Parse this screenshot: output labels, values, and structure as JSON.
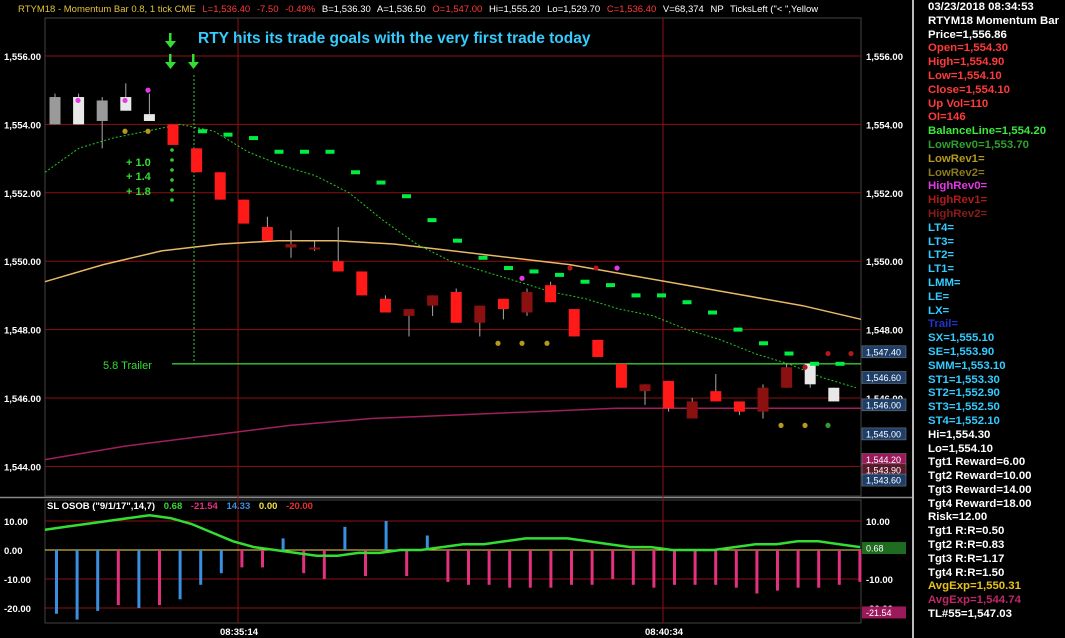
{
  "window": {
    "title_symbol": "RTYM18 - Momentum Bar 0.8, 1 tick  CME",
    "last": "L=1,536.40",
    "change": "-7.50",
    "change_pct": "-0.49%",
    "bid": "B=1,536.30",
    "ask": "A=1,536.50",
    "open": "O=1,547.00",
    "hi": "Hi=1,555.20",
    "lo": "Lo=1,529.70",
    "close": "C=1,536.40",
    "volume": "V=68,374",
    "np": "NP",
    "ticks_left": "TicksLeft (\"< \",Yellow",
    "annotation": "RTY hits its trade goals with the very first trade today",
    "trailer_label": "5.8 Trailer",
    "target_labels": [
      "1.0",
      "1.4",
      "1.8"
    ],
    "time_labels": [
      "08:35:14",
      "08:40:34"
    ]
  },
  "chart_data": [
    {
      "type": "candlestick",
      "symbol": "RTYM18",
      "price_axis": {
        "ticks": [
          1544.0,
          1546.0,
          1548.0,
          1550.0,
          1552.0,
          1554.0,
          1556.0
        ],
        "tick_labels": [
          "1,544.00",
          "1,546.00",
          "1,548.00",
          "1,550.00",
          "1,552.00",
          "1,554.00",
          "1,556.00"
        ],
        "ylim": [
          1543.6,
          1556.5
        ]
      },
      "candles": [
        {
          "o": 1554.8,
          "h": 1554.9,
          "l": 1554.0,
          "c": 1554.0,
          "color": "gray"
        },
        {
          "o": 1554.0,
          "h": 1554.9,
          "l": 1554.0,
          "c": 1554.8,
          "color": "white"
        },
        {
          "o": 1554.7,
          "h": 1554.8,
          "l": 1553.3,
          "c": 1554.1,
          "color": "gray"
        },
        {
          "o": 1554.4,
          "h": 1555.2,
          "l": 1554.4,
          "c": 1554.8,
          "color": "white"
        },
        {
          "o": 1554.1,
          "h": 1554.9,
          "l": 1554.1,
          "c": 1554.3,
          "color": "white"
        },
        {
          "o": 1554.0,
          "h": 1554.0,
          "l": 1553.4,
          "c": 1553.4,
          "color": "red"
        },
        {
          "o": 1553.3,
          "h": 1553.3,
          "l": 1552.6,
          "c": 1552.6,
          "color": "red"
        },
        {
          "o": 1552.6,
          "h": 1552.6,
          "l": 1551.8,
          "c": 1551.8,
          "color": "red"
        },
        {
          "o": 1551.8,
          "h": 1551.8,
          "l": 1551.1,
          "c": 1551.1,
          "color": "red"
        },
        {
          "o": 1551.0,
          "h": 1551.3,
          "l": 1550.6,
          "c": 1550.6,
          "color": "red"
        },
        {
          "o": 1550.5,
          "h": 1550.9,
          "l": 1550.1,
          "c": 1550.4,
          "color": "darkred"
        },
        {
          "o": 1550.4,
          "h": 1550.6,
          "l": 1550.3,
          "c": 1550.4,
          "color": "darkred"
        },
        {
          "o": 1550.0,
          "h": 1551.0,
          "l": 1549.7,
          "c": 1549.7,
          "color": "red"
        },
        {
          "o": 1549.7,
          "h": 1549.7,
          "l": 1549.0,
          "c": 1549.0,
          "color": "red"
        },
        {
          "o": 1548.9,
          "h": 1549.0,
          "l": 1548.5,
          "c": 1548.5,
          "color": "red"
        },
        {
          "o": 1548.6,
          "h": 1548.6,
          "l": 1547.8,
          "c": 1548.4,
          "color": "darkred"
        },
        {
          "o": 1549.0,
          "h": 1549.0,
          "l": 1548.4,
          "c": 1548.7,
          "color": "darkred"
        },
        {
          "o": 1549.1,
          "h": 1549.2,
          "l": 1548.2,
          "c": 1548.2,
          "color": "red"
        },
        {
          "o": 1548.7,
          "h": 1548.7,
          "l": 1547.8,
          "c": 1548.2,
          "color": "darkred"
        },
        {
          "o": 1548.9,
          "h": 1548.9,
          "l": 1548.3,
          "c": 1548.6,
          "color": "red"
        },
        {
          "o": 1549.1,
          "h": 1549.2,
          "l": 1548.4,
          "c": 1548.5,
          "color": "darkred"
        },
        {
          "o": 1549.3,
          "h": 1549.4,
          "l": 1548.8,
          "c": 1548.8,
          "color": "red"
        },
        {
          "o": 1548.6,
          "h": 1548.6,
          "l": 1547.8,
          "c": 1547.8,
          "color": "red"
        },
        {
          "o": 1547.7,
          "h": 1547.7,
          "l": 1547.2,
          "c": 1547.2,
          "color": "red"
        },
        {
          "o": 1547.0,
          "h": 1547.0,
          "l": 1546.3,
          "c": 1546.3,
          "color": "red"
        },
        {
          "o": 1546.4,
          "h": 1546.4,
          "l": 1545.8,
          "c": 1546.2,
          "color": "darkred"
        },
        {
          "o": 1546.5,
          "h": 1546.5,
          "l": 1545.6,
          "c": 1545.7,
          "color": "red"
        },
        {
          "o": 1545.9,
          "h": 1546.0,
          "l": 1545.4,
          "c": 1545.4,
          "color": "darkred"
        },
        {
          "o": 1546.2,
          "h": 1546.7,
          "l": 1545.9,
          "c": 1545.9,
          "color": "red"
        },
        {
          "o": 1545.9,
          "h": 1545.9,
          "l": 1545.5,
          "c": 1545.6,
          "color": "red"
        },
        {
          "o": 1546.3,
          "h": 1546.4,
          "l": 1545.4,
          "c": 1545.6,
          "color": "darkred"
        },
        {
          "o": 1546.9,
          "h": 1547.0,
          "l": 1546.3,
          "c": 1546.3,
          "color": "darkred"
        },
        {
          "o": 1546.4,
          "h": 1546.8,
          "l": 1546.3,
          "c": 1547.0,
          "color": "white"
        },
        {
          "o": 1546.3,
          "h": 1546.3,
          "l": 1545.9,
          "c": 1545.9,
          "color": "white"
        }
      ],
      "trail_stop": [
        1553.8,
        1553.7,
        1553.6,
        1553.2,
        1553.2,
        1553.2,
        1552.6,
        1552.3,
        1551.9,
        1551.2,
        1550.6,
        1550.1,
        1549.8,
        1549.7,
        1549.6,
        1549.4,
        1549.3,
        1549.0,
        1549.0,
        1548.8,
        1548.5,
        1548.0,
        1547.6,
        1547.3,
        1547.0,
        1547.0
      ],
      "balance_line": [
        1552.6,
        1553.3,
        1553.6,
        1553.8,
        1554.0,
        1553.8,
        1553.2,
        1552.8,
        1552.5,
        1552.0,
        1551.2,
        1550.5,
        1550.0,
        1549.7,
        1549.4,
        1549.1,
        1548.9,
        1548.6,
        1548.4,
        1548.0,
        1547.7,
        1547.3,
        1547.0,
        1546.6,
        1546.3
      ],
      "avg_exp_1": [
        1549.4,
        1549.9,
        1550.3,
        1550.5,
        1550.6,
        1550.6,
        1550.5,
        1550.3,
        1550.1,
        1549.9,
        1549.6,
        1549.3,
        1549.0,
        1548.7,
        1548.3
      ],
      "avg_exp_2": [
        1544.2,
        1544.6,
        1544.9,
        1545.2,
        1545.4,
        1545.5,
        1545.6,
        1545.7,
        1545.7,
        1545.7,
        1545.7
      ],
      "trailer_price": 1547.0,
      "right_tags": [
        {
          "text": "1,547.40",
          "color": "#1f3f6b",
          "value": 1547.35
        },
        {
          "text": "1,546.60",
          "color": "#1f3f6b",
          "value": 1546.6
        },
        {
          "text": "1,546.00",
          "color": "#1f3f6b",
          "value": 1545.8
        },
        {
          "text": "1,545.00",
          "color": "#1f3f6b",
          "value": 1544.95
        },
        {
          "text": "1,544.20",
          "color": "#9c1a5b",
          "value": 1544.2
        },
        {
          "text": "1,543.90",
          "color": "#5a1a2a",
          "value": 1543.9
        },
        {
          "text": "1,543.60",
          "color": "#1f3f6b",
          "value": 1543.6
        }
      ]
    },
    {
      "type": "bar",
      "title": "SL  OSOB (\"9/1/17\",14,7)",
      "legend_values": [
        {
          "text": "0.68",
          "color": "#39d539"
        },
        {
          "text": "-21.54",
          "color": "#e2317e"
        },
        {
          "text": "14.33",
          "color": "#3a8fe0"
        },
        {
          "text": "0.00",
          "color": "#f2e14a"
        },
        {
          "text": "-20.00",
          "color": "#e23131"
        }
      ],
      "y_ticks": [
        10.0,
        0.0,
        -10.0,
        -20.0
      ],
      "y_tick_labels": [
        "10.00",
        "0.00",
        "-10.00",
        "-20.00"
      ],
      "ylim": [
        -23,
        13
      ],
      "bars": [
        -22,
        -24,
        -21,
        -19,
        -20,
        -19,
        -17,
        -12,
        -8,
        -6,
        -6,
        4,
        -8,
        -10,
        8,
        -9,
        10,
        -9,
        5,
        -11,
        -12,
        -12,
        -13,
        -13,
        -13,
        -12,
        -12,
        -10,
        -12,
        -13,
        -12,
        -12,
        -12,
        -13,
        -15,
        -14,
        -13,
        -13,
        -12,
        -11
      ],
      "bar_colors": [
        "blue",
        "blue",
        "blue",
        "pink",
        "blue",
        "pink",
        "blue",
        "blue",
        "blue",
        "pink",
        "pink",
        "blue",
        "pink",
        "pink",
        "blue",
        "pink",
        "blue",
        "pink",
        "blue",
        "pink",
        "pink",
        "pink",
        "pink",
        "pink",
        "pink",
        "pink",
        "pink",
        "pink",
        "pink",
        "pink",
        "pink",
        "pink",
        "pink",
        "pink",
        "pink",
        "pink",
        "pink",
        "pink",
        "pink",
        "pink"
      ],
      "green_line": [
        7,
        8,
        9,
        10,
        11,
        12,
        11,
        9,
        6,
        3,
        1,
        0,
        -1,
        -2,
        -2,
        -1,
        -1,
        0,
        0,
        1,
        2,
        2,
        3,
        4,
        4,
        4,
        3,
        2,
        1,
        1,
        0,
        0,
        0,
        1,
        2,
        2,
        3,
        3,
        2,
        1
      ],
      "right_tags": [
        {
          "text": "0.68",
          "color": "#1f6b1f",
          "value": 0.68
        },
        {
          "text": "-21.54",
          "color": "#9c1a5b",
          "value": -21.54
        }
      ]
    }
  ],
  "data_panel": {
    "datetime": "03/23/2018 08:34:53",
    "symbol": "RTYM18 Momentum Bar",
    "lines": [
      {
        "text": "Price=1,556.86",
        "color": "#ffffff"
      },
      {
        "text": "Open=1,554.30",
        "color": "#ff3a3a"
      },
      {
        "text": "High=1,554.90",
        "color": "#ff3a3a"
      },
      {
        "text": "Low=1,554.10",
        "color": "#ff3a3a"
      },
      {
        "text": "Close=1,554.10",
        "color": "#ff3a3a"
      },
      {
        "text": "Up Vol=110",
        "color": "#ff3a3a"
      },
      {
        "text": "OI=146",
        "color": "#ff3a3a"
      },
      {
        "text": "BalanceLine=1,554.20",
        "color": "#3ce83c"
      },
      {
        "text": "LowRev0=1,553.70",
        "color": "#2fa02f"
      },
      {
        "text": "LowRev1=",
        "color": "#b39a1e"
      },
      {
        "text": "LowRev2=",
        "color": "#8a7a1e"
      },
      {
        "text": "HighRev0=",
        "color": "#e23ae2"
      },
      {
        "text": "HighRev1=",
        "color": "#b21a1a"
      },
      {
        "text": "HighRev2=",
        "color": "#8a1a1a"
      },
      {
        "text": "LT4=",
        "color": "#33ccff"
      },
      {
        "text": "LT3=",
        "color": "#33ccff"
      },
      {
        "text": "LT2=",
        "color": "#33ccff"
      },
      {
        "text": "LT1=",
        "color": "#33ccff"
      },
      {
        "text": "LMM=",
        "color": "#33ccff"
      },
      {
        "text": "LE=",
        "color": "#33ccff"
      },
      {
        "text": "LX=",
        "color": "#33ccff"
      },
      {
        "text": "Trail=",
        "color": "#2233cc"
      },
      {
        "text": "SX=1,555.10",
        "color": "#33ccff"
      },
      {
        "text": "SE=1,553.90",
        "color": "#33ccff"
      },
      {
        "text": "SMM=1,553.10",
        "color": "#33ccff"
      },
      {
        "text": "ST1=1,553.30",
        "color": "#33ccff"
      },
      {
        "text": "ST2=1,552.90",
        "color": "#33ccff"
      },
      {
        "text": "ST3=1,552.50",
        "color": "#33ccff"
      },
      {
        "text": "ST4=1,552.10",
        "color": "#33ccff"
      },
      {
        "text": "Hi=1,554.30",
        "color": "#ffffff"
      },
      {
        "text": "Lo=1,554.10",
        "color": "#ffffff"
      },
      {
        "text": "Tgt1 Reward=6.00",
        "color": "#ffffff"
      },
      {
        "text": "Tgt2 Reward=10.00",
        "color": "#ffffff"
      },
      {
        "text": "Tgt3 Reward=14.00",
        "color": "#ffffff"
      },
      {
        "text": "Tgt4 Reward=18.00",
        "color": "#ffffff"
      },
      {
        "text": "Risk=12.00",
        "color": "#ffffff"
      },
      {
        "text": "Tgt1 R:R=0.50",
        "color": "#ffffff"
      },
      {
        "text": "Tgt2 R:R=0.83",
        "color": "#ffffff"
      },
      {
        "text": "Tgt3 R:R=1.17",
        "color": "#ffffff"
      },
      {
        "text": "Tgt4 R:R=1.50",
        "color": "#ffffff"
      },
      {
        "text": "AvgExp=1,550.31",
        "color": "#e8c21a"
      },
      {
        "text": "AvgExp=1,544.74",
        "color": "#c2256b"
      },
      {
        "text": "TL#55=1,547.03",
        "color": "#ffffff"
      }
    ]
  },
  "colors": {
    "background": "#000000",
    "grid": "#8b1010",
    "axis_text": "#ffffff",
    "title_yellow": "#e3c33b",
    "annotation": "#33ccff",
    "trailer": "#33cc33",
    "trail_stop": "#00ee44",
    "balance_line": "#22cc22",
    "avg_exp_1": "#e8b865",
    "avg_exp_2": "#a0205a",
    "candle_red": "#ff1a1a",
    "candle_darkred": "#8b1010",
    "candle_white": "#e8e8e8",
    "candle_gray": "#9a9a9a",
    "osob_blue": "#3a8fe0",
    "osob_pink": "#e2317e",
    "osob_line": "#33dd33",
    "osob_zero": "#f2e14a"
  }
}
